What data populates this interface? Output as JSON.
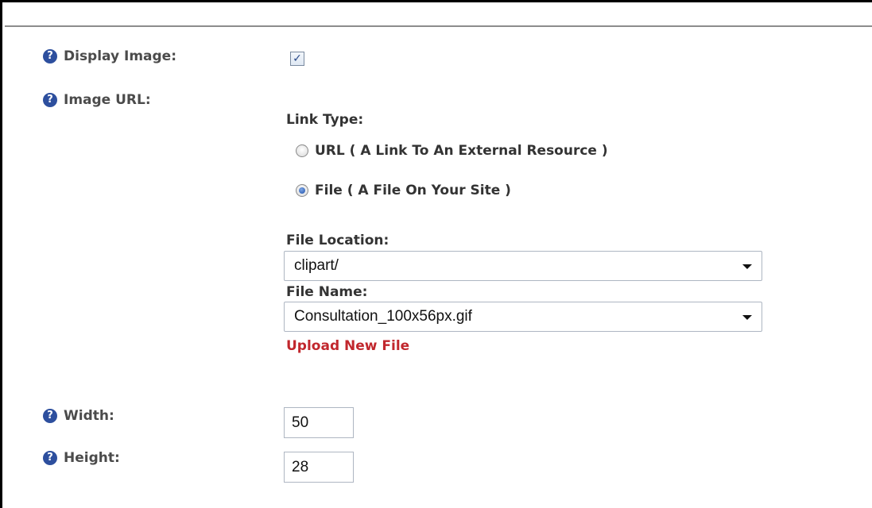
{
  "display_image": {
    "label": "Display Image:",
    "checked": true
  },
  "image_url": {
    "label": "Image URL:",
    "link_type": {
      "label": "Link Type:",
      "options": [
        {
          "label": "URL ( A Link To An External Resource )",
          "selected": false
        },
        {
          "label": "File ( A File On Your Site )",
          "selected": true
        }
      ]
    },
    "file_location": {
      "label": "File Location:",
      "value": "clipart/"
    },
    "file_name": {
      "label": "File Name:",
      "value": "Consultation_100x56px.gif"
    },
    "upload_link": "Upload New File"
  },
  "width": {
    "label": "Width:",
    "value": "50"
  },
  "height": {
    "label": "Height:",
    "value": "28"
  },
  "icons": {
    "help": "question-circle-icon"
  },
  "colors": {
    "help_icon": "#2d4f9e",
    "upload_link": "#c1272d",
    "label_text": "#4b4b4b"
  }
}
